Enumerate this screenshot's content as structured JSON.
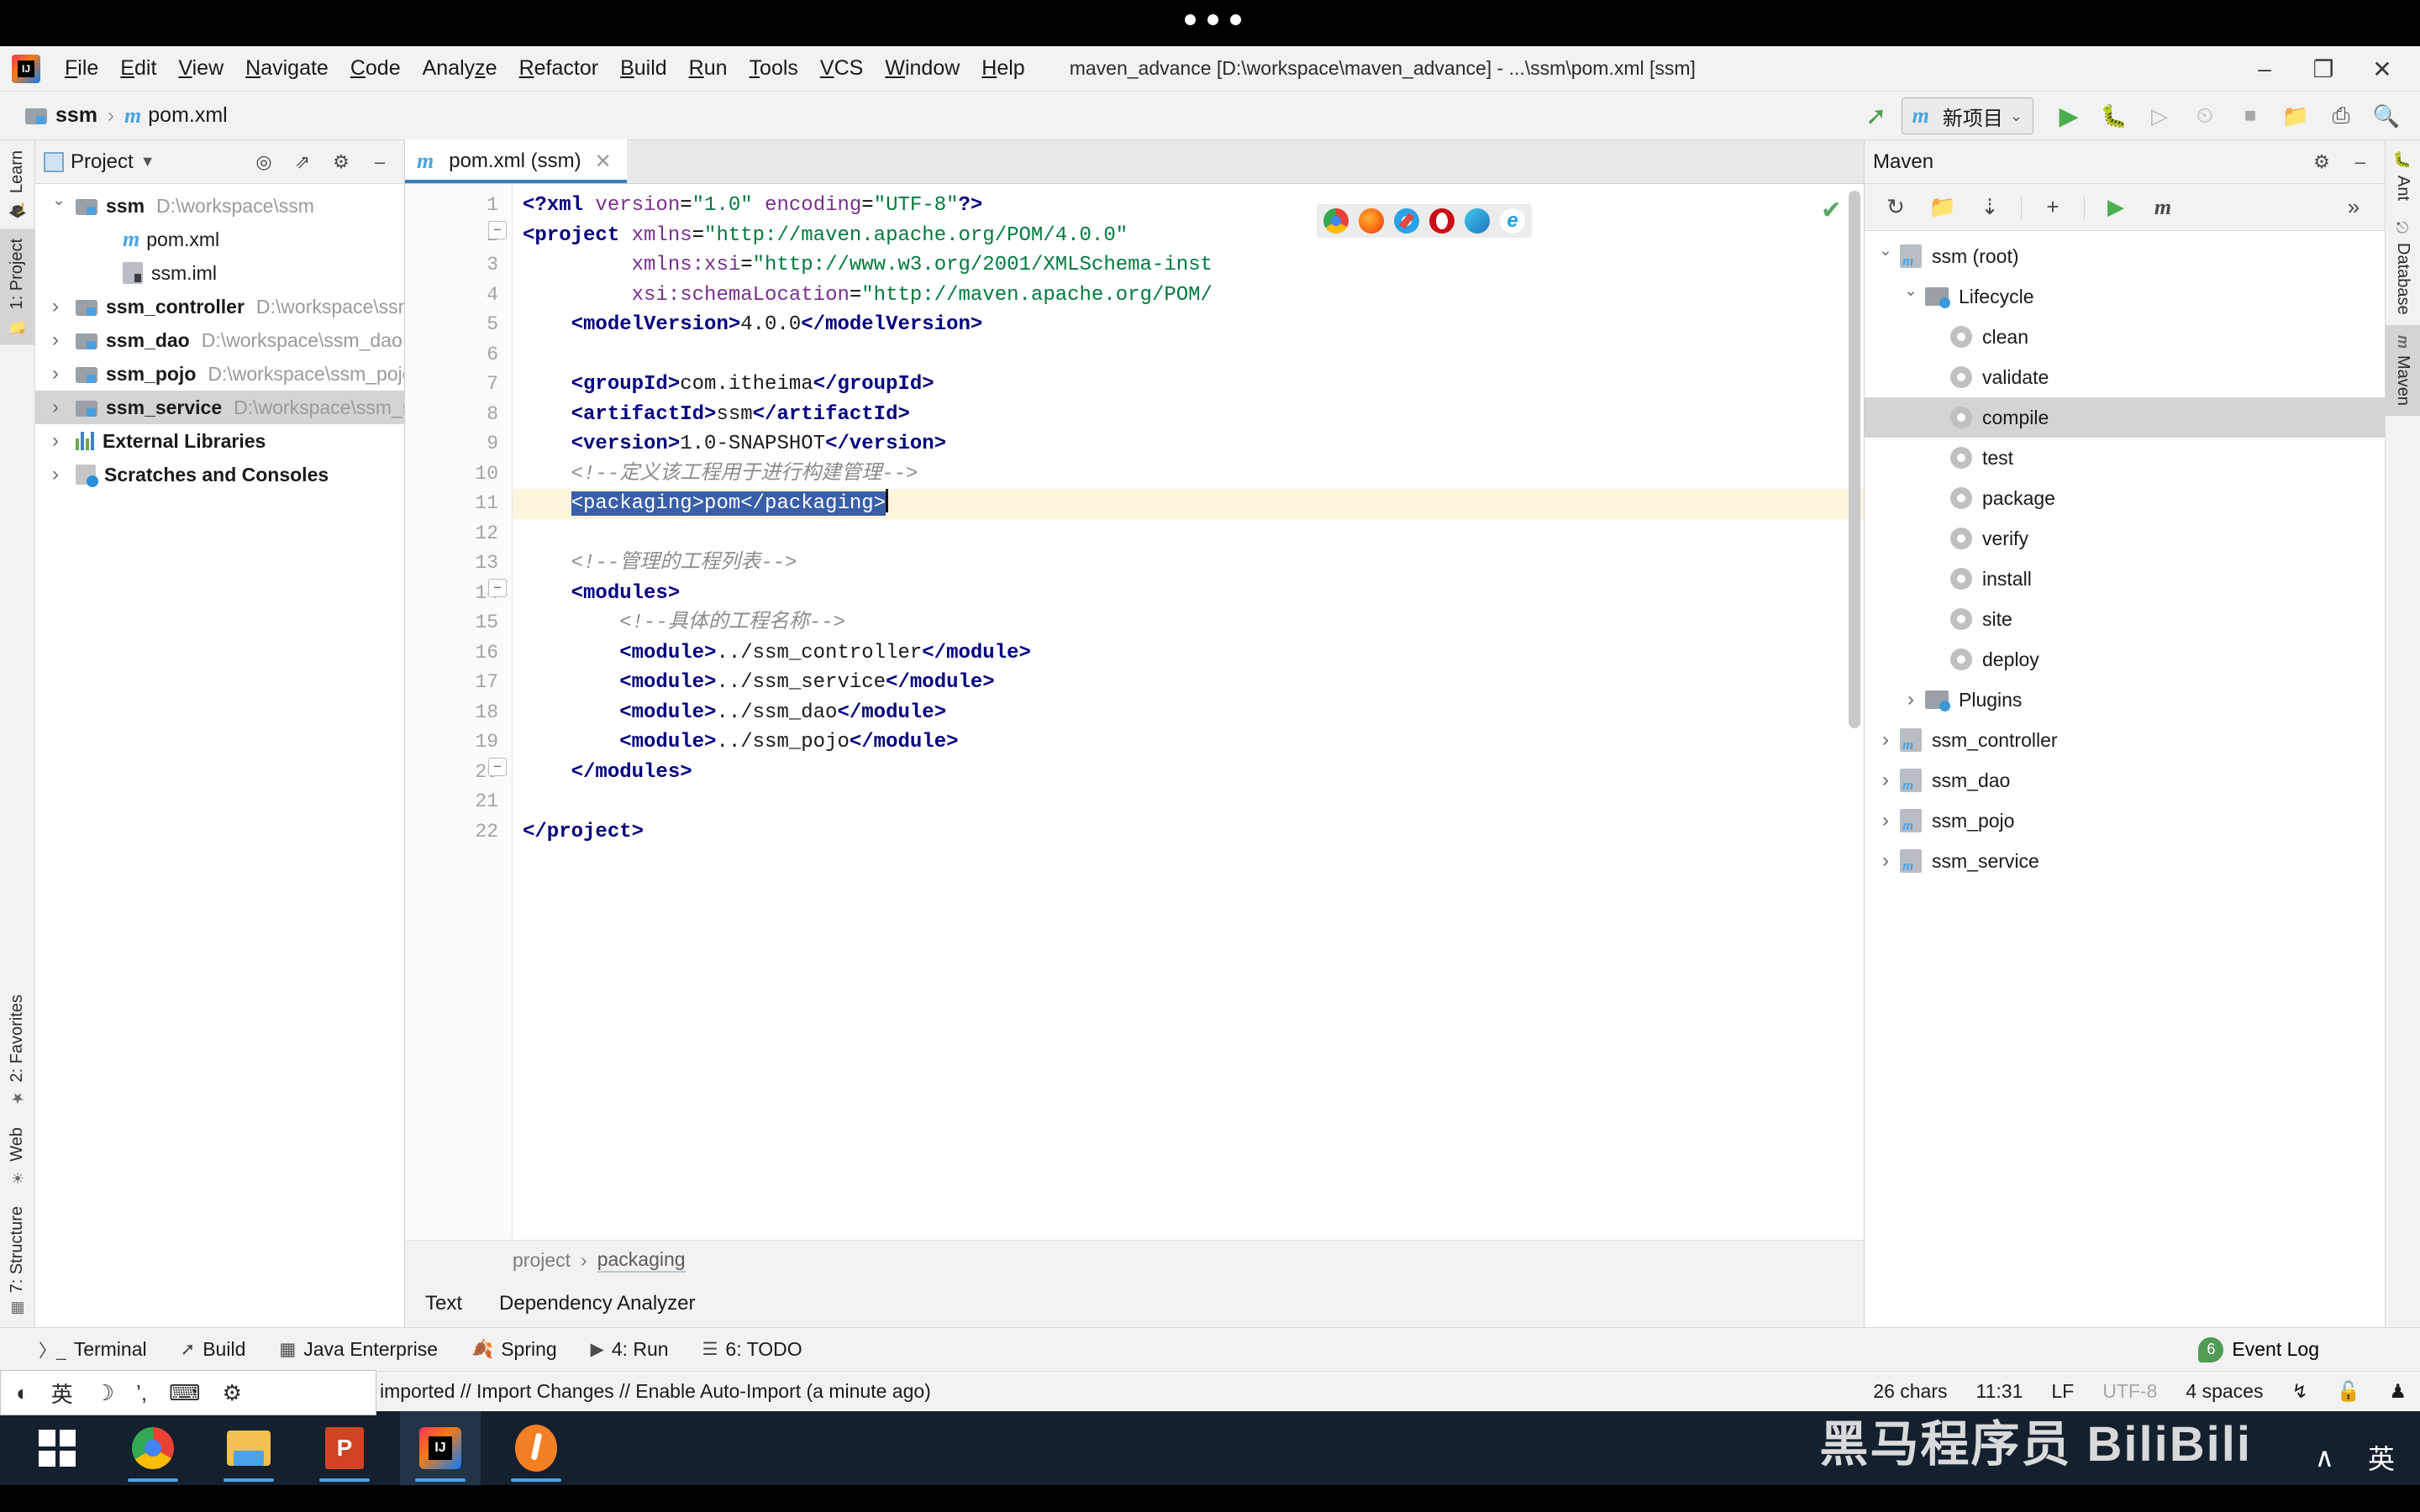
{
  "window": {
    "title": "maven_advance [D:\\workspace\\maven_advance] - ...\\ssm\\pom.xml [ssm]",
    "minimize": "–",
    "maximize": "❐",
    "close": "✕"
  },
  "menu": {
    "items": [
      "File",
      "Edit",
      "View",
      "Navigate",
      "Code",
      "Analyze",
      "Refactor",
      "Build",
      "Run",
      "Tools",
      "VCS",
      "Window",
      "Help"
    ]
  },
  "navbar": {
    "crumb_project": "ssm",
    "crumb_sep": "›",
    "crumb_file": "pom.xml",
    "run_config": "新项目",
    "chevron": "⌄"
  },
  "left_tool_tabs": [
    {
      "label": "Learn",
      "icon": "graduation-cap-icon",
      "active": false
    },
    {
      "label": "1: Project",
      "icon": "folder-icon",
      "active": true
    },
    {
      "label": "2: Favorites",
      "icon": "star-icon",
      "active": false
    },
    {
      "label": "Web",
      "icon": "globe-icon",
      "active": false
    },
    {
      "label": "7: Structure",
      "icon": "structure-icon",
      "active": false
    }
  ],
  "right_tool_tabs": [
    {
      "label": "Ant",
      "icon": "ant-icon",
      "active": false
    },
    {
      "label": "Database",
      "icon": "database-icon",
      "active": false
    },
    {
      "label": "Maven",
      "icon": "maven-m-icon",
      "active": true
    }
  ],
  "project_panel": {
    "title": "Project",
    "dropdown": "▼",
    "tree": [
      {
        "name": "ssm",
        "path": "D:\\workspace\\ssm",
        "arrow": "open",
        "indent": 0,
        "icon": "module-folder-icon",
        "selected": false
      },
      {
        "name": "pom.xml",
        "path": "",
        "arrow": "none",
        "indent": 2,
        "icon": "maven-m-icon",
        "selected": false
      },
      {
        "name": "ssm.iml",
        "path": "",
        "arrow": "none",
        "indent": 2,
        "icon": "iml-file-icon",
        "selected": false
      },
      {
        "name": "ssm_controller",
        "path": "D:\\workspace\\ssm_controller",
        "arrow": "closed",
        "indent": 0,
        "icon": "module-folder-icon",
        "selected": false
      },
      {
        "name": "ssm_dao",
        "path": "D:\\workspace\\ssm_dao",
        "arrow": "closed",
        "indent": 0,
        "icon": "module-folder-icon",
        "selected": false
      },
      {
        "name": "ssm_pojo",
        "path": "D:\\workspace\\ssm_pojo",
        "arrow": "closed",
        "indent": 0,
        "icon": "module-folder-icon",
        "selected": false
      },
      {
        "name": "ssm_service",
        "path": "D:\\workspace\\ssm_service",
        "arrow": "closed",
        "indent": 0,
        "icon": "module-folder-icon",
        "selected": true
      },
      {
        "name": "External Libraries",
        "path": "",
        "arrow": "closed",
        "indent": 0,
        "icon": "libraries-icon",
        "selected": false
      },
      {
        "name": "Scratches and Consoles",
        "path": "",
        "arrow": "closed",
        "indent": 0,
        "icon": "scratches-icon",
        "selected": false
      }
    ]
  },
  "editor": {
    "tab_label": "pom.xml (ssm)",
    "tab_close": "✕",
    "inspection_ok": "✔",
    "breadcrumb": [
      "project",
      "packaging"
    ],
    "breadcrumb_sep": "›",
    "bottom_tabs": [
      "Text",
      "Dependency Analyzer"
    ],
    "line_count": 22,
    "lines": [
      {
        "n": 1,
        "html": "<span class=\"tag\">&lt;?xml</span> <span class=\"attr\">version</span>=<span class=\"str\">\"1.0\"</span> <span class=\"attr\">encoding</span>=<span class=\"str\">\"UTF-8\"</span><span class=\"tag\">?&gt;</span>"
      },
      {
        "n": 2,
        "html": "<span class=\"tag\">&lt;project</span> <span class=\"attr\">xmlns</span>=<span class=\"str\">\"http://maven.apache.org/POM/4.0.0\"</span>"
      },
      {
        "n": 3,
        "html": "         <span class=\"attr\">xmlns:xsi</span>=<span class=\"str\">\"http://www.w3.org/2001/XMLSchema-inst</span>"
      },
      {
        "n": 4,
        "html": "         <span class=\"attr\">xsi:schemaLocation</span>=<span class=\"str\">\"http://maven.apache.org/POM/</span>"
      },
      {
        "n": 5,
        "html": "    <span class=\"tag\">&lt;modelVersion&gt;</span><span class=\"txtv\">4.0.0</span><span class=\"tag\">&lt;/modelVersion&gt;</span>"
      },
      {
        "n": 6,
        "html": ""
      },
      {
        "n": 7,
        "html": "    <span class=\"tag\">&lt;groupId&gt;</span><span class=\"txtv\">com.itheima</span><span class=\"tag\">&lt;/groupId&gt;</span>"
      },
      {
        "n": 8,
        "html": "    <span class=\"tag\">&lt;artifactId&gt;</span><span class=\"txtv\">ssm</span><span class=\"tag\">&lt;/artifactId&gt;</span>"
      },
      {
        "n": 9,
        "html": "    <span class=\"tag\">&lt;version&gt;</span><span class=\"txtv\">1.0-SNAPSHOT</span><span class=\"tag\">&lt;/version&gt;</span>"
      },
      {
        "n": 10,
        "html": "    <span class=\"cmt\">&lt;!--定义该工程用于进行构建管理--&gt;</span>"
      },
      {
        "n": 11,
        "html": "    <span class=\"selpack\">&lt;packaging&gt;pom&lt;/packaging&gt;</span><span class=\"caret\"></span>",
        "highlight": true,
        "bulb": true
      },
      {
        "n": 12,
        "html": ""
      },
      {
        "n": 13,
        "html": "    <span class=\"cmt\">&lt;!--管理的工程列表--&gt;</span>"
      },
      {
        "n": 14,
        "html": "    <span class=\"tag\">&lt;modules&gt;</span>"
      },
      {
        "n": 15,
        "html": "        <span class=\"cmt\">&lt;!--具体的工程名称--&gt;</span>"
      },
      {
        "n": 16,
        "html": "        <span class=\"tag\">&lt;module&gt;</span><span class=\"txtv\">../ssm_controller</span><span class=\"tag\">&lt;/module&gt;</span>"
      },
      {
        "n": 17,
        "html": "        <span class=\"tag\">&lt;module&gt;</span><span class=\"txtv\">../ssm_service</span><span class=\"tag\">&lt;/module&gt;</span>"
      },
      {
        "n": 18,
        "html": "        <span class=\"tag\">&lt;module&gt;</span><span class=\"txtv\">../ssm_dao</span><span class=\"tag\">&lt;/module&gt;</span>"
      },
      {
        "n": 19,
        "html": "        <span class=\"tag\">&lt;module&gt;</span><span class=\"txtv\">../ssm_pojo</span><span class=\"tag\">&lt;/module&gt;</span>"
      },
      {
        "n": 20,
        "html": "    <span class=\"tag\">&lt;/modules&gt;</span>"
      },
      {
        "n": 21,
        "html": ""
      },
      {
        "n": 22,
        "html": "<span class=\"tag\">&lt;/project&gt;</span>"
      }
    ],
    "browser_icons": [
      "chrome-icon",
      "firefox-icon",
      "safari-icon",
      "opera-icon",
      "edge-icon",
      "ie-icon"
    ]
  },
  "maven_panel": {
    "title": "Maven",
    "toolbar_icons": [
      "reload-icon",
      "add-maven-project-icon",
      "download-sources-icon",
      "plus-icon",
      "run-icon",
      "execute-maven-goal-icon",
      "more-icon"
    ],
    "more": "»",
    "tree": [
      {
        "label": "ssm (root)",
        "arrow": "open",
        "indent": 0,
        "icon": "maven-project-icon",
        "selected": false
      },
      {
        "label": "Lifecycle",
        "arrow": "open",
        "indent": 1,
        "icon": "lifecycle-folder-icon",
        "selected": false
      },
      {
        "label": "clean",
        "arrow": "none",
        "indent": 2,
        "icon": "goal-gear-icon",
        "selected": false
      },
      {
        "label": "validate",
        "arrow": "none",
        "indent": 2,
        "icon": "goal-gear-icon",
        "selected": false
      },
      {
        "label": "compile",
        "arrow": "none",
        "indent": 2,
        "icon": "goal-gear-icon",
        "selected": true
      },
      {
        "label": "test",
        "arrow": "none",
        "indent": 2,
        "icon": "goal-gear-icon",
        "selected": false
      },
      {
        "label": "package",
        "arrow": "none",
        "indent": 2,
        "icon": "goal-gear-icon",
        "selected": false
      },
      {
        "label": "verify",
        "arrow": "none",
        "indent": 2,
        "icon": "goal-gear-icon",
        "selected": false
      },
      {
        "label": "install",
        "arrow": "none",
        "indent": 2,
        "icon": "goal-gear-icon",
        "selected": false
      },
      {
        "label": "site",
        "arrow": "none",
        "indent": 2,
        "icon": "goal-gear-icon",
        "selected": false
      },
      {
        "label": "deploy",
        "arrow": "none",
        "indent": 2,
        "icon": "goal-gear-icon",
        "selected": false
      },
      {
        "label": "Plugins",
        "arrow": "closed",
        "indent": 1,
        "icon": "plugins-folder-icon",
        "selected": false
      },
      {
        "label": "ssm_controller",
        "arrow": "closed",
        "indent": 0,
        "icon": "maven-project-icon",
        "selected": false
      },
      {
        "label": "ssm_dao",
        "arrow": "closed",
        "indent": 0,
        "icon": "maven-project-icon",
        "selected": false
      },
      {
        "label": "ssm_pojo",
        "arrow": "closed",
        "indent": 0,
        "icon": "maven-project-icon",
        "selected": false
      },
      {
        "label": "ssm_service",
        "arrow": "closed",
        "indent": 0,
        "icon": "maven-project-icon",
        "selected": false
      }
    ]
  },
  "bottom_bar": {
    "items": [
      {
        "label": "Terminal",
        "icon": "terminal-icon"
      },
      {
        "label": "Build",
        "icon": "build-hammer-icon"
      },
      {
        "label": "Java Enterprise",
        "icon": "java-enterprise-icon"
      },
      {
        "label": "Spring",
        "icon": "spring-leaf-icon"
      },
      {
        "label": "4: Run",
        "icon": "run-play-icon"
      },
      {
        "label": "6: TODO",
        "icon": "todo-list-icon"
      }
    ],
    "event_log": "Event Log",
    "event_log_count": "6"
  },
  "status_bar": {
    "message": "imported // Import Changes // Enable Auto-Import (a minute ago)",
    "chars": "26 chars",
    "position": "11:31",
    "line_sep": "LF",
    "encoding": "UTF-8",
    "indent": "4 spaces",
    "ime_icons": [
      "ime-mode-icon",
      "英",
      "☽",
      "’,",
      "keyboard-icon",
      "gear-icon"
    ],
    "right_icons": [
      "branch-icon",
      "lock-icon",
      "hat-icon"
    ]
  },
  "taskbar": {
    "items": [
      {
        "name": "start-button",
        "icon": "windows-logo-icon",
        "active": false
      },
      {
        "name": "chrome",
        "icon": "chrome-icon",
        "active": false
      },
      {
        "name": "file-explorer",
        "icon": "folder-icon",
        "active": false
      },
      {
        "name": "powerpoint",
        "icon": "powerpoint-icon",
        "active": false
      },
      {
        "name": "intellij-idea",
        "icon": "intellij-icon",
        "active": true
      },
      {
        "name": "java",
        "icon": "java-icon",
        "active": false
      }
    ],
    "watermark": "黑马程序员  BiliBili",
    "tray": [
      "∧",
      "英"
    ]
  },
  "colors": {
    "accent": "#3d7ab8",
    "selection": "#3a5fa8",
    "highlight_row": "#fdf6dd",
    "tree_selected": "#d4d4d4",
    "tag": "#000080",
    "string": "#007a3d",
    "attribute": "#7a2f8f",
    "comment": "#8c8c8c",
    "green_run": "#4caf50"
  }
}
